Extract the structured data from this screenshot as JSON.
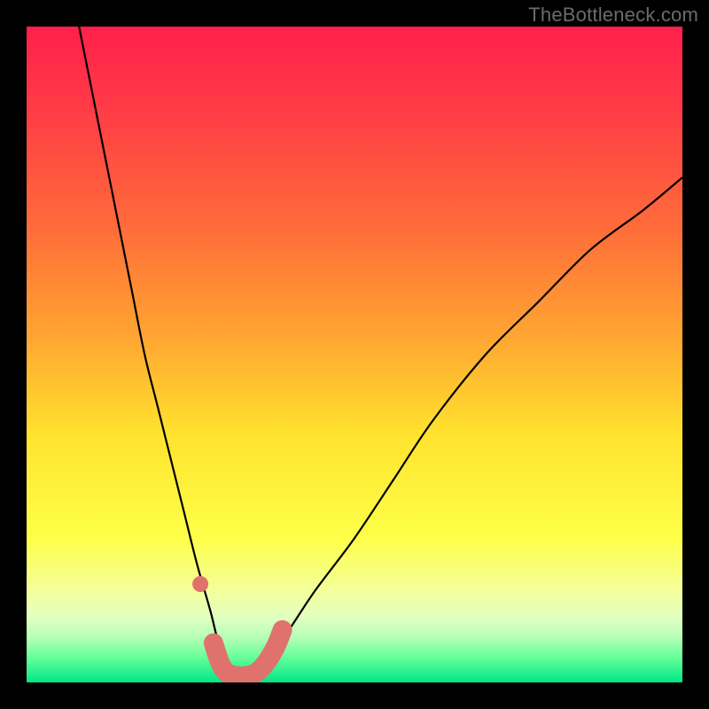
{
  "watermark": {
    "text": "TheBottleneck.com"
  },
  "chart_data": {
    "type": "line",
    "title": "",
    "xlabel": "",
    "ylabel": "",
    "xlim": [
      0,
      100
    ],
    "ylim": [
      0,
      100
    ],
    "grid": false,
    "legend": false,
    "background_gradient": {
      "stops": [
        {
          "pct": 0,
          "color": "#ff1f4b"
        },
        {
          "pct": 12,
          "color": "#ff3a46"
        },
        {
          "pct": 30,
          "color": "#ff6a3a"
        },
        {
          "pct": 48,
          "color": "#ffa831"
        },
        {
          "pct": 62,
          "color": "#ffe22e"
        },
        {
          "pct": 78,
          "color": "#fdff48"
        },
        {
          "pct": 86,
          "color": "#f4ff9a"
        },
        {
          "pct": 90,
          "color": "#e2ffc0"
        },
        {
          "pct": 93,
          "color": "#b8ffb8"
        },
        {
          "pct": 96,
          "color": "#6bff9a"
        },
        {
          "pct": 100,
          "color": "#00e887"
        }
      ]
    },
    "series": [
      {
        "name": "bottleneck-curve",
        "color": "#000000",
        "x": [
          8,
          10,
          12,
          14,
          16,
          18,
          20,
          22,
          24,
          26,
          28,
          29,
          30,
          31,
          32,
          33,
          34,
          35,
          37,
          40,
          44,
          50,
          56,
          62,
          70,
          78,
          86,
          94,
          100
        ],
        "y": [
          100,
          90,
          80,
          70,
          60,
          50,
          42,
          34,
          26,
          18,
          11,
          7,
          4,
          2,
          1,
          1,
          1,
          2,
          4,
          8,
          14,
          22,
          31,
          40,
          50,
          58,
          66,
          72,
          77
        ]
      }
    ],
    "highlight": {
      "name": "optimal-range-marker",
      "color": "#e0726e",
      "points": [
        {
          "x": 26.5,
          "y": 15
        },
        {
          "x": 28.5,
          "y": 6
        },
        {
          "x": 29.5,
          "y": 3
        },
        {
          "x": 30.5,
          "y": 1.5
        },
        {
          "x": 32,
          "y": 1
        },
        {
          "x": 33.5,
          "y": 1
        },
        {
          "x": 35,
          "y": 1.5
        },
        {
          "x": 36.5,
          "y": 3
        },
        {
          "x": 38,
          "y": 5.5
        },
        {
          "x": 39,
          "y": 8
        }
      ]
    }
  }
}
